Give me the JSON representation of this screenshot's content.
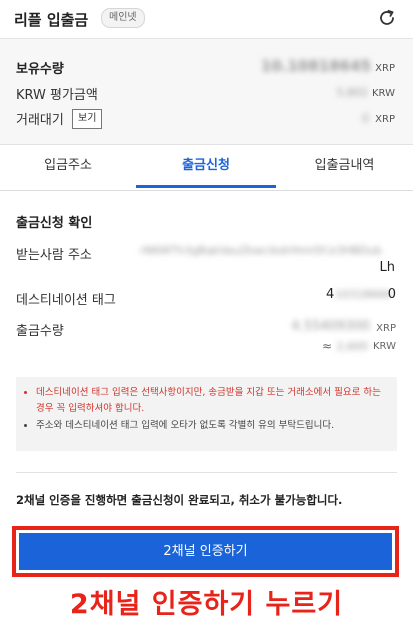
{
  "header": {
    "title": "리플 입출금",
    "badge": "메인넷"
  },
  "holdings": {
    "balance_label": "보유수량",
    "balance_value": "10.10818645",
    "balance_unit": "XRP",
    "krw_label": "KRW 평가금액",
    "krw_value": "5,802",
    "krw_unit": "KRW",
    "pending_label": "거래대기",
    "pending_button": "보기",
    "pending_value": "0",
    "pending_unit": "XRP"
  },
  "tabs": [
    {
      "label": "입금주소",
      "active": false
    },
    {
      "label": "출금신청",
      "active": true
    },
    {
      "label": "입출금내역",
      "active": false
    }
  ],
  "confirm": {
    "title": "출금신청 확인",
    "recipient_label": "받는사람 주소",
    "recipient_value": "rN6WTh3gBqkVauZkwcibdrHmrDCe3HBDub",
    "recipient_tail": "Lh",
    "tag_label": "데스티네이션 태그",
    "tag_first": "4",
    "tag_middle": "10318666",
    "tag_last": "0",
    "amount_label": "출금수량",
    "amount_value": "4.55409300",
    "amount_unit": "XRP",
    "approx_symbol": "≈",
    "approx_value": "2,600",
    "approx_unit": "KRW"
  },
  "notice": {
    "items": [
      "데스티네이션 태그 입력은 선택사항이지만, 송금받을 지갑 또는 거래소에서 필요로 하는 경우 꼭 입력하셔야 합니다.",
      "주소와 데스티네이션 태그 입력에 오타가 없도록 각별히 유의 부탁드립니다."
    ]
  },
  "confirm_text": "2채널 인증을 진행하면 출금신청이 완료되고, 취소가 불가능합니다.",
  "cta_label": "2채널 인증하기",
  "callout": "2채널 인증하기 누르기",
  "colors": {
    "accent": "#1a63d8",
    "highlight": "#e8231a",
    "warning_text": "#d0342c"
  }
}
